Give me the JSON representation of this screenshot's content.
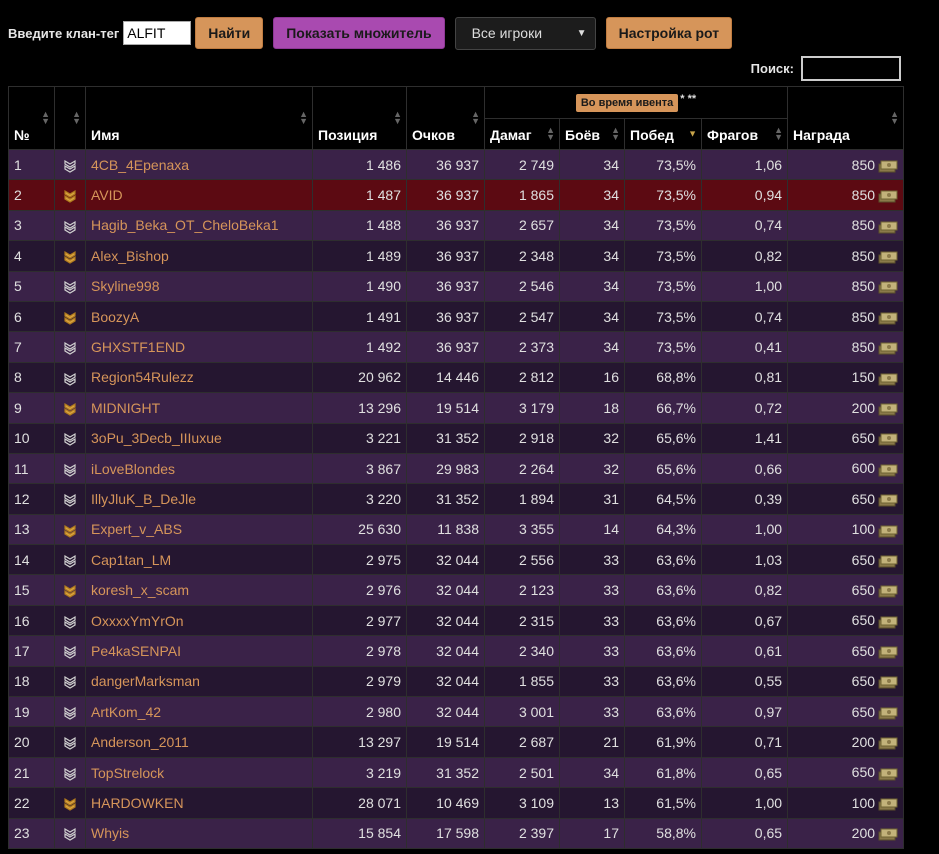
{
  "toolbar": {
    "clan_label": "Введите клан-тег",
    "clan_value": "ALFIT",
    "find_label": "Найти",
    "multiplier_label": "Показать множитель",
    "players_select": "Все игроки",
    "rot_settings_label": "Настройка рот"
  },
  "search": {
    "label": "Поиск:",
    "value": ""
  },
  "columns": {
    "num": "№",
    "name": "Имя",
    "position": "Позиция",
    "points": "Очков",
    "event_badge": "Во время ивента",
    "event_note": "* **",
    "damage": "Дамаг",
    "battles": "Боёв",
    "wins": "Побед",
    "frags": "Фрагов",
    "reward": "Награда"
  },
  "colors": {
    "accent": "#d6955a",
    "purple_button": "#a94ab0",
    "row_odd": "#3a2248",
    "row_even": "#251630",
    "row_highlight": "#5c0a12"
  },
  "rows": [
    {
      "n": "1",
      "rank": "chevron-icon",
      "name": "4CB_4Epenaxa",
      "position": "1 486",
      "points": "36 937",
      "damage": "2 749",
      "battles": "34",
      "wins": "73,5%",
      "frags": "1,06",
      "reward": "850"
    },
    {
      "n": "2",
      "rank": "gold-chevron-icon",
      "name": "AVID",
      "position": "1 487",
      "points": "36 937",
      "damage": "1 865",
      "battles": "34",
      "wins": "73,5%",
      "frags": "0,94",
      "reward": "850"
    },
    {
      "n": "3",
      "rank": "chevron-icon",
      "name": "Hagib_Beka_OT_CheloBeka1",
      "position": "1 488",
      "points": "36 937",
      "damage": "2 657",
      "battles": "34",
      "wins": "73,5%",
      "frags": "0,74",
      "reward": "850"
    },
    {
      "n": "4",
      "rank": "gold-chevron-icon",
      "name": "Alex_Bishop",
      "position": "1 489",
      "points": "36 937",
      "damage": "2 348",
      "battles": "34",
      "wins": "73,5%",
      "frags": "0,82",
      "reward": "850"
    },
    {
      "n": "5",
      "rank": "chevron-icon",
      "name": "Skyline998",
      "position": "1 490",
      "points": "36 937",
      "damage": "2 546",
      "battles": "34",
      "wins": "73,5%",
      "frags": "1,00",
      "reward": "850"
    },
    {
      "n": "6",
      "rank": "gold-chevron-icon",
      "name": "BoozyA",
      "position": "1 491",
      "points": "36 937",
      "damage": "2 547",
      "battles": "34",
      "wins": "73,5%",
      "frags": "0,74",
      "reward": "850"
    },
    {
      "n": "7",
      "rank": "chevron-icon",
      "name": "GHXSTF1END",
      "position": "1 492",
      "points": "36 937",
      "damage": "2 373",
      "battles": "34",
      "wins": "73,5%",
      "frags": "0,41",
      "reward": "850"
    },
    {
      "n": "8",
      "rank": "chevron-icon",
      "name": "Region54Rulezz",
      "position": "20 962",
      "points": "14 446",
      "damage": "2 812",
      "battles": "16",
      "wins": "68,8%",
      "frags": "0,81",
      "reward": "150"
    },
    {
      "n": "9",
      "rank": "gold-chevron-icon",
      "name": "MIDNIGHT",
      "position": "13 296",
      "points": "19 514",
      "damage": "3 179",
      "battles": "18",
      "wins": "66,7%",
      "frags": "0,72",
      "reward": "200"
    },
    {
      "n": "10",
      "rank": "chevron-icon",
      "name": "3oPu_3Decb_IIIuxue",
      "position": "3 221",
      "points": "31 352",
      "damage": "2 918",
      "battles": "32",
      "wins": "65,6%",
      "frags": "1,41",
      "reward": "650"
    },
    {
      "n": "11",
      "rank": "chevron-icon",
      "name": "iLoveBlondes",
      "position": "3 867",
      "points": "29 983",
      "damage": "2 264",
      "battles": "32",
      "wins": "65,6%",
      "frags": "0,66",
      "reward": "600"
    },
    {
      "n": "12",
      "rank": "chevron-icon",
      "name": "IllyJluK_B_DeJle",
      "position": "3 220",
      "points": "31 352",
      "damage": "1 894",
      "battles": "31",
      "wins": "64,5%",
      "frags": "0,39",
      "reward": "650"
    },
    {
      "n": "13",
      "rank": "gold-chevron-icon",
      "name": "Expert_v_ABS",
      "position": "25 630",
      "points": "11 838",
      "damage": "3 355",
      "battles": "14",
      "wins": "64,3%",
      "frags": "1,00",
      "reward": "100"
    },
    {
      "n": "14",
      "rank": "chevron-icon",
      "name": "Cap1tan_LM",
      "position": "2 975",
      "points": "32 044",
      "damage": "2 556",
      "battles": "33",
      "wins": "63,6%",
      "frags": "1,03",
      "reward": "650"
    },
    {
      "n": "15",
      "rank": "gold-chevron-icon",
      "name": "koresh_x_scam",
      "position": "2 976",
      "points": "32 044",
      "damage": "2 123",
      "battles": "33",
      "wins": "63,6%",
      "frags": "0,82",
      "reward": "650"
    },
    {
      "n": "16",
      "rank": "chevron-icon",
      "name": "OxxxxYmYrOn",
      "position": "2 977",
      "points": "32 044",
      "damage": "2 315",
      "battles": "33",
      "wins": "63,6%",
      "frags": "0,67",
      "reward": "650"
    },
    {
      "n": "17",
      "rank": "chevron-icon",
      "name": "Pe4kaSENPAI",
      "position": "2 978",
      "points": "32 044",
      "damage": "2 340",
      "battles": "33",
      "wins": "63,6%",
      "frags": "0,61",
      "reward": "650"
    },
    {
      "n": "18",
      "rank": "chevron-icon",
      "name": "dangerMarksman",
      "position": "2 979",
      "points": "32 044",
      "damage": "1 855",
      "battles": "33",
      "wins": "63,6%",
      "frags": "0,55",
      "reward": "650"
    },
    {
      "n": "19",
      "rank": "chevron-icon",
      "name": "ArtKom_42",
      "position": "2 980",
      "points": "32 044",
      "damage": "3 001",
      "battles": "33",
      "wins": "63,6%",
      "frags": "0,97",
      "reward": "650"
    },
    {
      "n": "20",
      "rank": "chevron-icon",
      "name": "Anderson_2011",
      "position": "13 297",
      "points": "19 514",
      "damage": "2 687",
      "battles": "21",
      "wins": "61,9%",
      "frags": "0,71",
      "reward": "200"
    },
    {
      "n": "21",
      "rank": "chevron-icon",
      "name": "TopStrelock",
      "position": "3 219",
      "points": "31 352",
      "damage": "2 501",
      "battles": "34",
      "wins": "61,8%",
      "frags": "0,65",
      "reward": "650"
    },
    {
      "n": "22",
      "rank": "gold-chevron-icon",
      "name": "HARDOWKEN",
      "position": "28 071",
      "points": "10 469",
      "damage": "3 109",
      "battles": "13",
      "wins": "61,5%",
      "frags": "1,00",
      "reward": "100"
    },
    {
      "n": "23",
      "rank": "chevron-icon",
      "name": "Whyis",
      "position": "15 854",
      "points": "17 598",
      "damage": "2 397",
      "battles": "17",
      "wins": "58,8%",
      "frags": "0,65",
      "reward": "200"
    }
  ]
}
